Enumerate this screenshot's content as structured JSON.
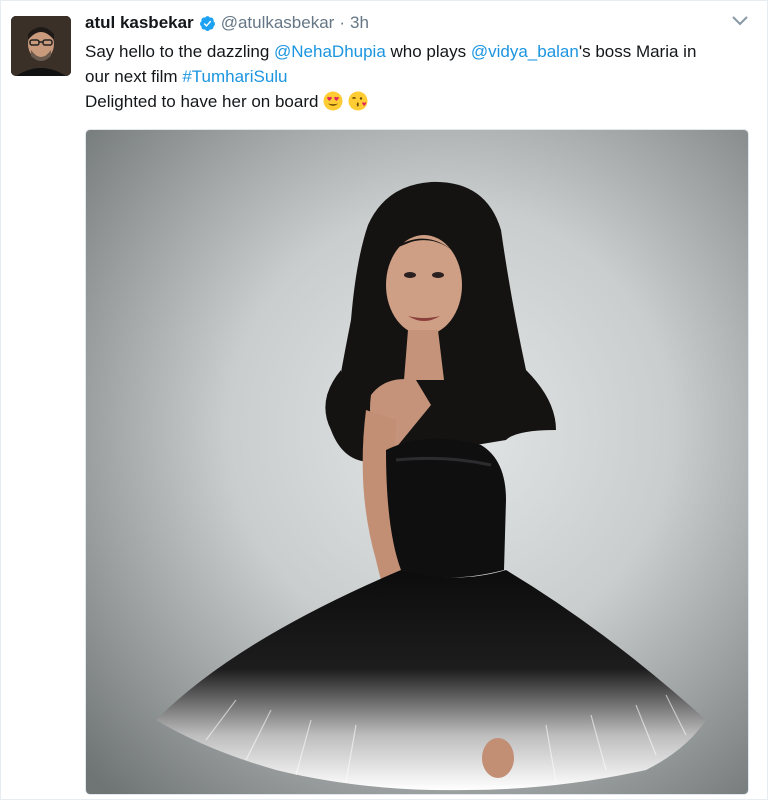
{
  "tweet": {
    "author_name": "atul kasbekar",
    "handle": "@atulkasbekar",
    "separator": "·",
    "time": "3h",
    "line1": {
      "prefix": "Say hello to the dazzling ",
      "mention1": "@NehaDhupia",
      "middle": " who plays ",
      "mention2": "@vidya_balan",
      "suffix": "'s boss Maria in"
    },
    "line2": {
      "prefix": "our next film ",
      "hashtag": "#TumhariSulu"
    },
    "line3": {
      "text": "Delighted to have her on board "
    }
  },
  "colors": {
    "link": "#1b95e0",
    "verified": "#1da1f2",
    "muted": "#657786"
  },
  "icons": [
    "verified-badge-icon",
    "caret-down-icon",
    "smiling-heart-eyes-emoji",
    "kissing-face-emoji"
  ]
}
